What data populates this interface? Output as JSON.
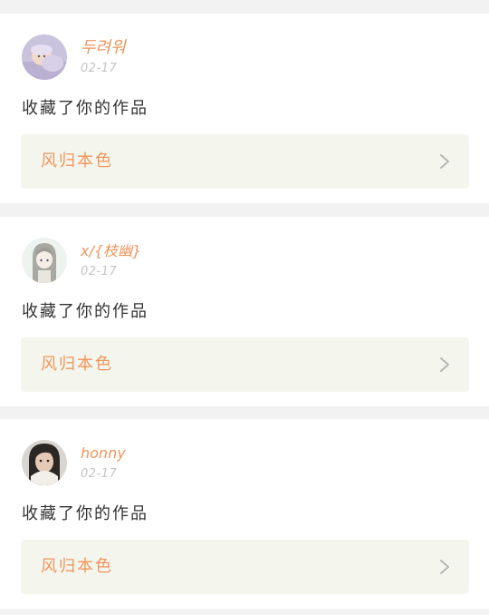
{
  "feed": {
    "items": [
      {
        "user": "두려워",
        "date": "02-17",
        "action": "收藏了你的作品",
        "work_title": "风归本色",
        "avatar_icon": "baby-photo-avatar"
      },
      {
        "user": "x/{枝幽}",
        "date": "02-17",
        "action": "收藏了你的作品",
        "work_title": "风归本色",
        "avatar_icon": "anime-girl-avatar"
      },
      {
        "user": "honny",
        "date": "02-17",
        "action": "收藏了你的作品",
        "work_title": "风归本色",
        "avatar_icon": "woman-portrait-avatar"
      }
    ]
  },
  "colors": {
    "accent": "#f0955d",
    "card_link_bg": "#f4f6ee",
    "page_bg": "#f2f2f2",
    "date_text": "#c4c4c4",
    "body_text": "#333333"
  }
}
